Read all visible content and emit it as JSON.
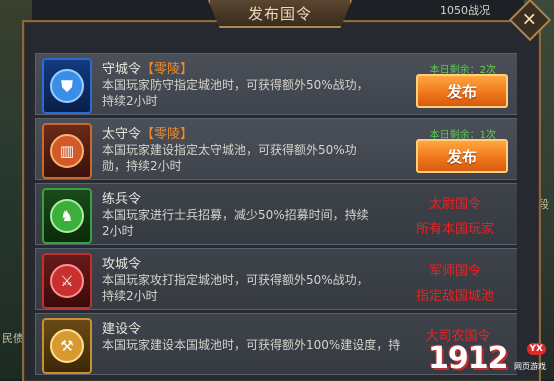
{
  "background": {
    "top_text": "1050战况",
    "left_text": "民债",
    "right_text": "段"
  },
  "dialog": {
    "title": "发布国令",
    "close_glyph": "✕"
  },
  "orders": [
    {
      "name": "守城令",
      "tag": "【零陵】",
      "desc": "本国玩家防守指定城池时，可获得额外50%战功，持续2小时",
      "remain_label": "本日剩余：",
      "remain_count": "2次",
      "button": "发布",
      "icon": "shield-icon"
    },
    {
      "name": "太守令",
      "tag": "【零陵】",
      "desc": "本国玩家建设指定太守城池，可获得额外50%功勋，持续2小时",
      "remain_label": "本日剩余：",
      "remain_count": "1次",
      "button": "发布",
      "icon": "gate-icon"
    },
    {
      "name": "练兵令",
      "desc": "本国玩家进行士兵招募，减少50%招募时间，持续2小时",
      "icon": "soldiers-icon"
    },
    {
      "name": "攻城令",
      "desc": "本国玩家攻打指定城池时，可获得额外50%战功，持续2小时",
      "icon": "crossed-swords-icon"
    },
    {
      "name": "建设令",
      "desc": "本国玩家建设本国城池时，可获得额外100%建设度，持",
      "icon": "hammer-icon"
    }
  ],
  "annotations": [
    {
      "line1": "太尉国令",
      "line2": "所有本国玩家"
    },
    {
      "line1": "军师国令",
      "line2": "指定敌国城池"
    },
    {
      "line1": "大司农国令"
    }
  ],
  "watermark": {
    "number": "1912",
    "badge": "YX",
    "subtitle": "网页游戏"
  }
}
